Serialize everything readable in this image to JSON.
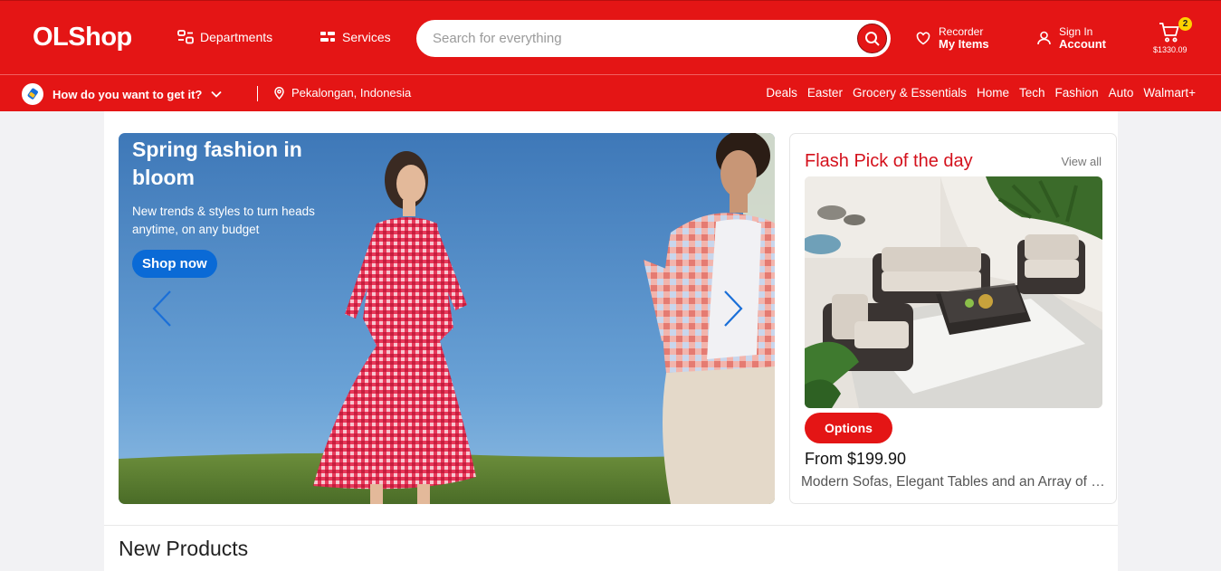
{
  "header": {
    "logo": "OLShop",
    "departments_label": "Departments",
    "services_label": "Services",
    "search_placeholder": "Search for everything",
    "reorder": {
      "small": "Recorder",
      "bold": "My Items"
    },
    "account": {
      "small": "Sign In",
      "bold": "Account"
    },
    "cart": {
      "count": "2",
      "total": "$1330.09"
    }
  },
  "subbar": {
    "delivery_label": "How do you want to get it?",
    "location": "Pekalongan, Indonesia",
    "categories": [
      "Deals",
      "Easter",
      "Grocery & Essentials",
      "Home",
      "Tech",
      "Fashion",
      "Auto",
      "Walmart+"
    ]
  },
  "hero": {
    "title": "Spring fashion in bloom",
    "subtitle": "New trends & styles to turn heads anytime, on any budget",
    "cta": "Shop now"
  },
  "flash": {
    "title": "Flash Pick of the day",
    "view_all": "View all",
    "options_label": "Options",
    "price": "From $199.90",
    "description": "Modern Sofas, Elegant Tables and an Array of Outdoor Furniture"
  },
  "section": {
    "title": "New Products"
  },
  "colors": {
    "brand_red": "#e41515",
    "cta_blue": "#0a6ad6",
    "badge_yellow": "#ffd200"
  }
}
